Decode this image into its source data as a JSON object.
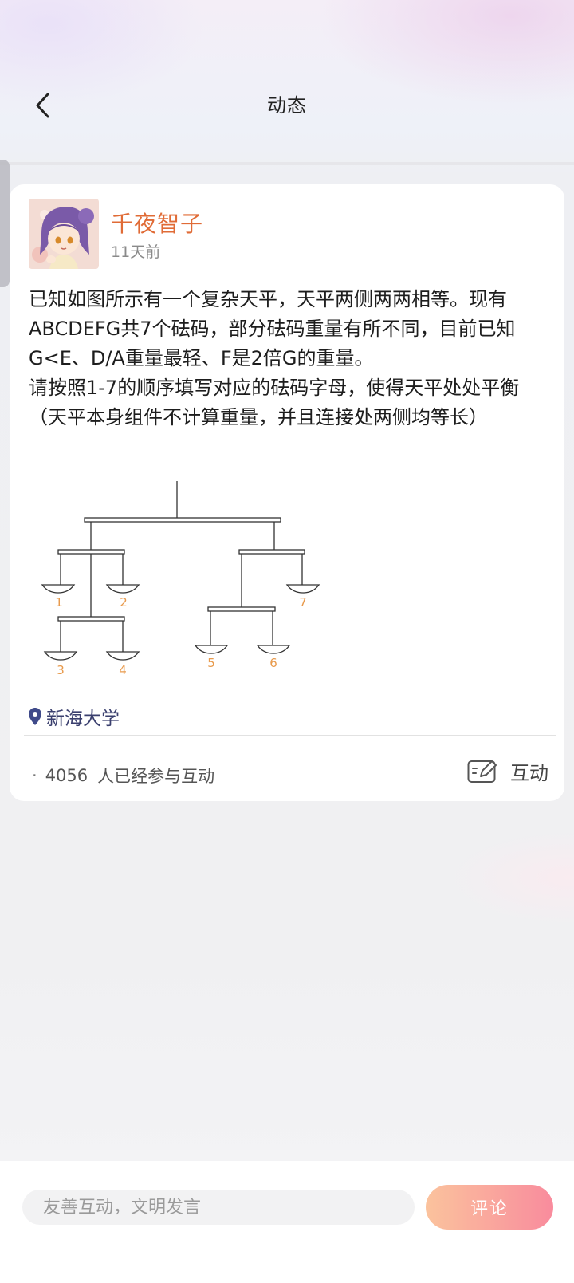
{
  "header": {
    "title": "动态",
    "back_icon": "chevron-left-icon"
  },
  "post": {
    "author": "千夜智子",
    "time": "11天前",
    "paragraphs": [
      "已知如图所示有一个复杂天平，天平两侧两两相等。现有ABCDEFG共7个砝码，部分砝码重量有所不同，目前已知G<E、D/A重量最轻、F是2倍G的重量。",
      "请按照1-7的顺序填写对应的砝码字母，使得天平处处平衡（天平本身组件不计算重量，并且连接处两侧均等长）"
    ],
    "diagram": {
      "pan_labels": [
        "1",
        "2",
        "3",
        "4",
        "5",
        "6",
        "7"
      ],
      "label_color": "#e89a4c"
    },
    "location": "新海大学",
    "location_icon": "location-pin-icon",
    "participants_count": "4056",
    "participants_text": "人已经参与互动",
    "interact_label": "互动",
    "interact_icon": "edit-note-icon"
  },
  "bottom_bar": {
    "comment_placeholder": "友善互动，文明发言",
    "comment_button": "评论"
  },
  "colors": {
    "author": "#e06b36",
    "location": "#3a3f6e",
    "button_gradient_start": "#fbb98c",
    "button_gradient_end": "#f8788d"
  }
}
